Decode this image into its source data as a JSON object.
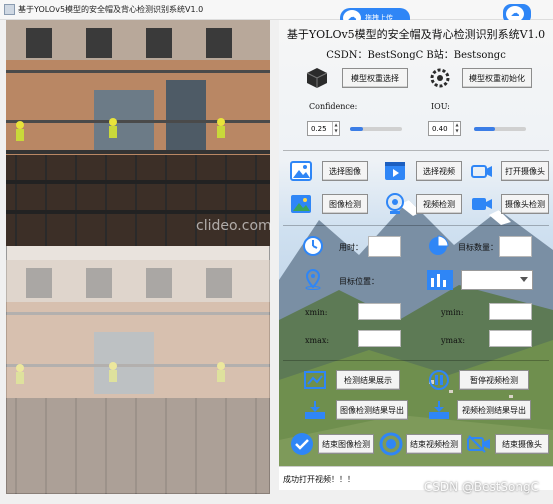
{
  "window": {
    "title": "基于YOLOv5模型的安全帽及背心检测识别系统V1.0",
    "upload_label": "拖拽上传"
  },
  "header": {
    "title": "基于YOLOv5模型的安全帽及背心检测识别系统V1.0",
    "subtitle": "CSDN：BestSongC   B站：Bestsongc"
  },
  "model": {
    "select_label": "模型权重选择",
    "init_label": "模型权重初始化"
  },
  "params": {
    "confidence_label": "Confidence:",
    "confidence_value": "0.25",
    "confidence_fraction": 0.25,
    "iou_label": "IOU:",
    "iou_value": "0.40",
    "iou_fraction": 0.4
  },
  "source_buttons": {
    "select_image": "选择图像",
    "select_video": "选择视频",
    "open_camera": "打开摄像头",
    "image_detect": "图像检测",
    "video_detect": "视频检测",
    "camera_detect": "摄像头检测"
  },
  "info": {
    "time_label": "用时：",
    "target_count_label": "目标数量：",
    "target_position_label": "目标位置：",
    "xmin_label": "xmin:",
    "ymin_label": "ymin:",
    "xmax_label": "xmax:",
    "ymax_label": "ymax:"
  },
  "actions": {
    "show_results": "检测结果展示",
    "pause_video": "暂停视频检测",
    "export_image_results": "图像检测结果导出",
    "export_video_results": "视频检测结果导出",
    "end_image": "结束图像检测",
    "end_video": "结束视频检测",
    "end_camera": "结束摄像头"
  },
  "status": {
    "message": "成功打开视频！！！"
  },
  "overlays": {
    "video_watermark": "clideo.com",
    "page_watermark": "CSDN @BestSongC"
  },
  "colors": {
    "accent": "#2f86f6",
    "slider_fill": "#3b7de6"
  }
}
